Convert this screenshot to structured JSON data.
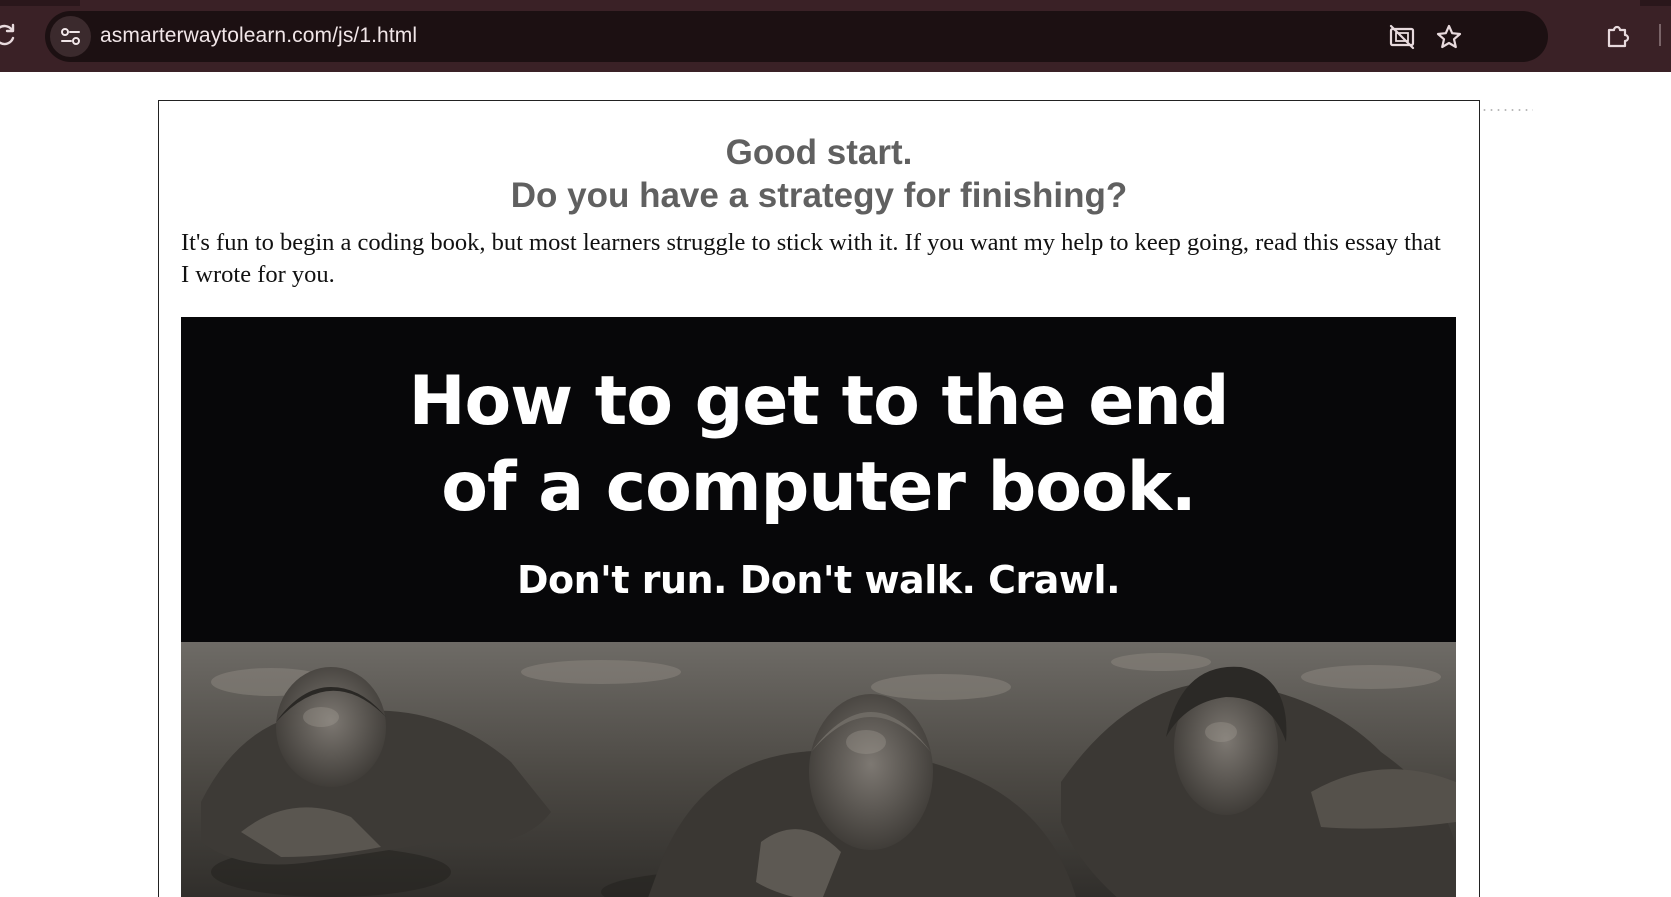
{
  "browser": {
    "url": "asmarterwaytolearn.com/js/1.html",
    "icons": {
      "reload": "reload-icon",
      "site_info": "tune-icon",
      "camera_blocked": "camera-off-icon",
      "bookmark": "star-icon",
      "extensions": "puzzle-icon"
    },
    "colors": {
      "frame": "#3a2126",
      "omnibox": "#1c1012",
      "url_text": "#f1e6e8"
    }
  },
  "page": {
    "headline_line1": "Good start.",
    "headline_line2": "Do you have a strategy for finishing?",
    "intro": "It's fun to begin a coding book, but most learners struggle to stick with it. If you want my help to keep going, read this essay that I wrote for you.",
    "banner": {
      "title_line1": "How to get to the end",
      "title_line2": "of a computer book.",
      "subtitle": "Don't run. Don't walk. Crawl."
    },
    "colors": {
      "headline": "#606060",
      "banner_background": "#070709",
      "banner_text": "#ffffff"
    }
  }
}
